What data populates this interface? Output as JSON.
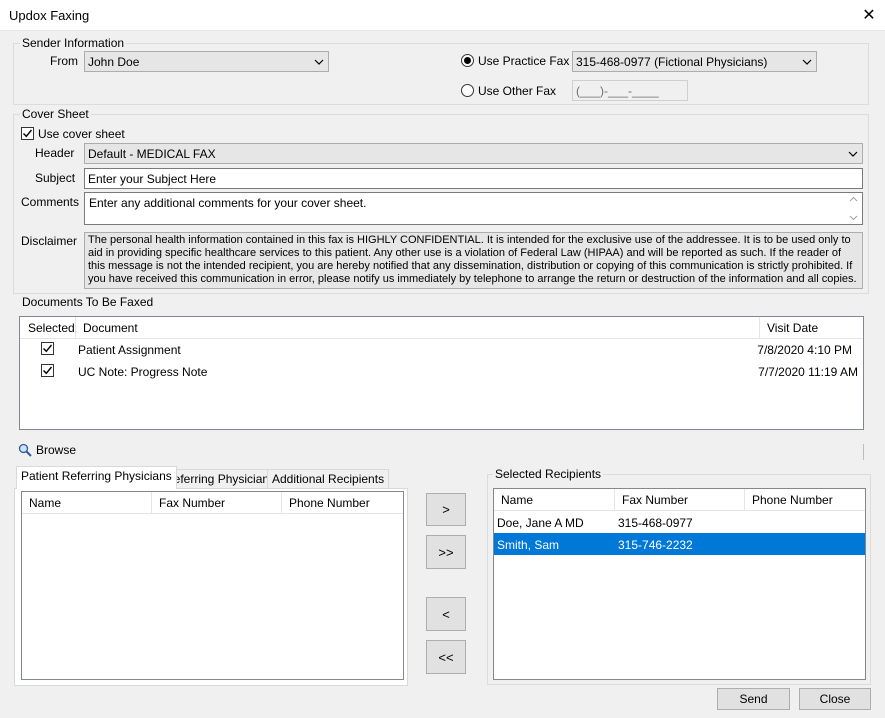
{
  "window": {
    "title": "Updox Faxing",
    "close_glyph": "✕"
  },
  "sender": {
    "group_label": "Sender Information",
    "from_label": "From",
    "from_value": "John Doe",
    "use_practice_fax_label": "Use Practice Fax",
    "practice_fax_value": "315-468-0977 (Fictional Physicians)",
    "use_other_fax_label": "Use Other Fax",
    "other_fax_mask": "(___)-___-____"
  },
  "cover": {
    "group_label": "Cover Sheet",
    "use_cover_label": "Use cover sheet",
    "header_label": "Header",
    "header_value": "Default - MEDICAL FAX",
    "subject_label": "Subject",
    "subject_value": "Enter your Subject Here",
    "comments_label": "Comments",
    "comments_value": "Enter any additional comments for your cover sheet.",
    "disclaimer_label": "Disclaimer",
    "disclaimer_text": "The personal health information contained in this fax is HIGHLY CONFIDENTIAL. It is intended for the exclusive use of the addressee. It is to be used only to aid in providing specific healthcare services to this patient. Any other use is a violation of Federal Law (HIPAA) and will be reported as such. If the reader of this message is not the intended recipient, you are hereby notified that any dissemination, distribution or copying of this communication is strictly prohibited. If you have received this communication in error, please notify us immediately by telephone to arrange the return or destruction of the information and all copies."
  },
  "documents": {
    "group_label": "Documents To Be Faxed",
    "columns": {
      "selected": "Selected",
      "document": "Document",
      "visit_date": "Visit Date"
    },
    "rows": [
      {
        "document": "Patient Assignment",
        "visit_date": "7/8/2020 4:10 PM"
      },
      {
        "document": "UC Note: Progress Note",
        "visit_date": "7/7/2020 11:19 AM"
      }
    ],
    "browse_label": "Browse"
  },
  "tabs": [
    "Patient Referring Physicians",
    "Referring Physicians",
    "Additional Recipients"
  ],
  "physicians": {
    "columns": {
      "name": "Name",
      "fax": "Fax Number",
      "phone": "Phone Number"
    }
  },
  "transfer_buttons": {
    "add": ">",
    "add_all": ">>",
    "remove": "<",
    "remove_all": "<<"
  },
  "recipients": {
    "group_label": "Selected Recipients",
    "columns": {
      "name": "Name",
      "fax": "Fax Number",
      "phone": "Phone Number"
    },
    "rows": [
      {
        "name": "Doe, Jane A MD",
        "fax": "315-468-0977",
        "phone": ""
      },
      {
        "name": "Smith, Sam",
        "fax": "315-746-2232",
        "phone": ""
      }
    ]
  },
  "footer": {
    "send_label": "Send",
    "close_label": "Close"
  },
  "colors": {
    "selection": "#0078d7",
    "background": "#f0f0f0"
  }
}
